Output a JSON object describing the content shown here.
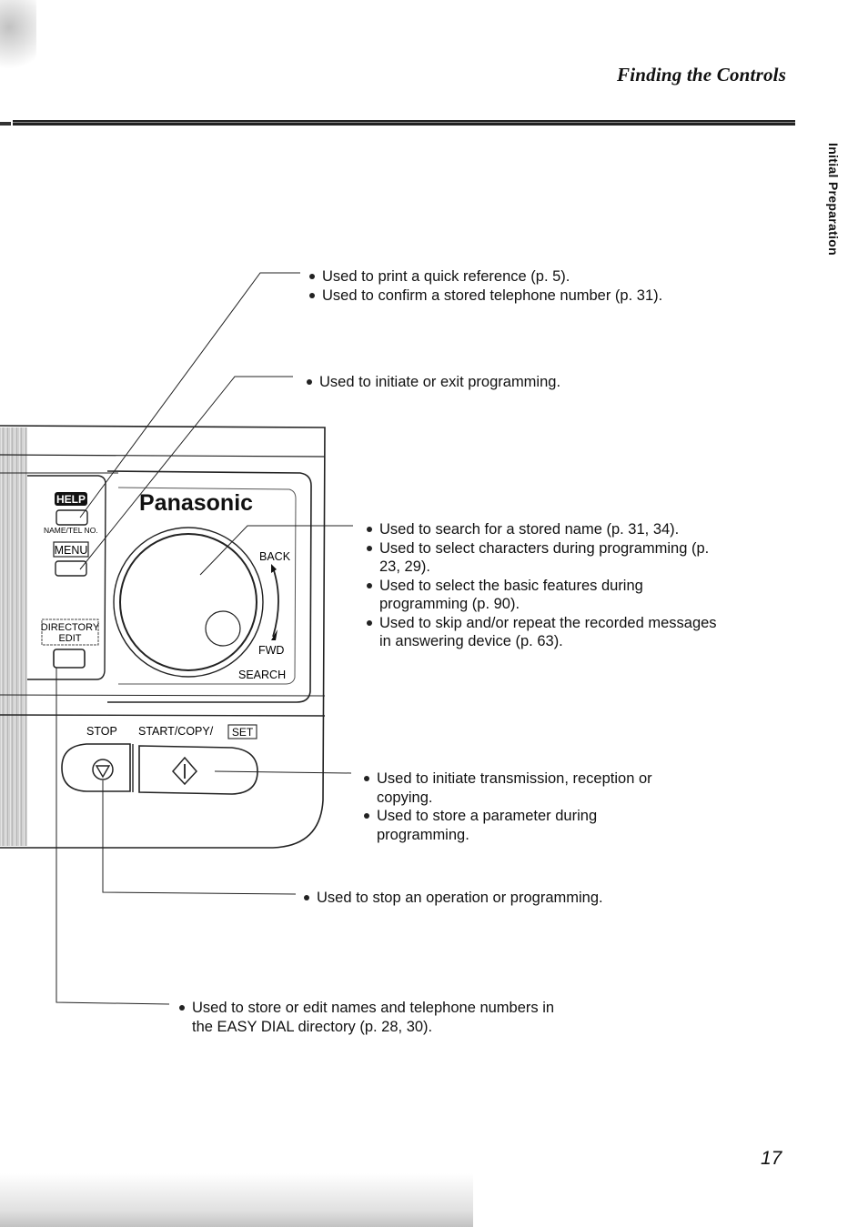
{
  "header": {
    "title": "Finding the Controls"
  },
  "side_tab": {
    "label": "Initial Preparation"
  },
  "device_panel": {
    "brand": "Panasonic",
    "buttons": {
      "help_label": "HELP",
      "name_tel_label": "NAME/TEL NO.",
      "menu_label": "MENU",
      "directory_edit_label_1": "DIRECTORY",
      "directory_edit_label_2": "EDIT",
      "stop_label": "STOP",
      "start_copy_label": "START/COPY/",
      "set_label": "SET"
    },
    "dial": {
      "back_label": "BACK",
      "fwd_label": "FWD",
      "search_label": "SEARCH"
    }
  },
  "callouts": {
    "help": [
      "Used to print a quick reference (p. 5).",
      "Used to confirm a stored telephone number (p. 31)."
    ],
    "menu": [
      "Used to initiate or exit programming."
    ],
    "jog_dial": [
      "Used to search for a stored name (p. 31, 34).",
      "Used to select characters during programming (p. 23, 29).",
      "Used to select the basic features during programming (p. 90).",
      "Used to skip and/or repeat the recorded messages in answering device (p. 63)."
    ],
    "start_copy_set": [
      "Used to initiate transmission, reception or copying.",
      "Used to store a parameter during programming."
    ],
    "stop": [
      "Used to stop an operation or programming."
    ],
    "directory_edit": [
      "Used to store or edit names and telephone numbers in the EASY DIAL directory (p. 28, 30)."
    ]
  },
  "footer": {
    "page_number": "17"
  }
}
